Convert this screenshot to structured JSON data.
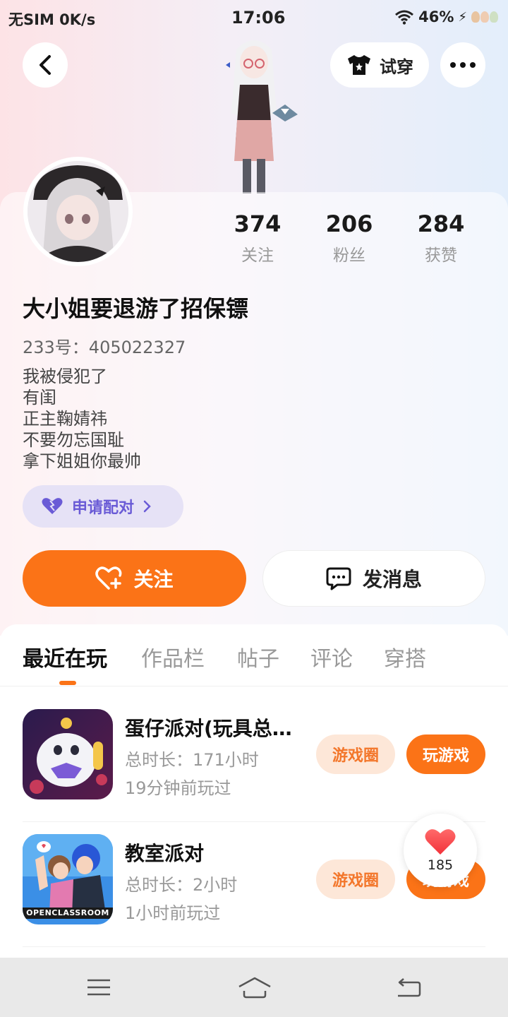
{
  "status_bar": {
    "carrier": "无SIM",
    "speed": "0K/s",
    "time": "17:06",
    "battery": "46%"
  },
  "header": {
    "tryon_label": "试穿"
  },
  "profile": {
    "stats": [
      {
        "value": "374",
        "label": "关注"
      },
      {
        "value": "206",
        "label": "粉丝"
      },
      {
        "value": "284",
        "label": "获赞"
      }
    ],
    "nickname": "大小姐要退游了招保镖",
    "uid": "233号：405022327",
    "bio": [
      "我被侵犯了",
      "有闺",
      "正主鞠婧祎",
      "不要勿忘国耻",
      "拿下姐姐你最帅"
    ],
    "pair_label": "申请配对",
    "follow_label": "关注",
    "message_label": "发消息"
  },
  "tabs": [
    {
      "label": "最近在玩",
      "active": true
    },
    {
      "label": "作品栏",
      "active": false
    },
    {
      "label": "帖子",
      "active": false
    },
    {
      "label": "评论",
      "active": false
    },
    {
      "label": "穿搭",
      "active": false
    }
  ],
  "games": [
    {
      "name": "蛋仔派对(玩具总…",
      "duration": "总时长：171小时",
      "last_played": "19分钟前玩过",
      "circle_label": "游戏圈",
      "play_label": "玩游戏"
    },
    {
      "name": "教室派对",
      "duration": "总时长：2小时",
      "last_played": "1小时前玩过",
      "circle_label": "游戏圈",
      "play_label": "玩游戏"
    }
  ],
  "like_float": {
    "count": "185"
  },
  "game_logo_text": "OPENCLASSROOM",
  "colors": {
    "accent": "#fb7317",
    "pair_bg": "#e6e2f6",
    "pair_text": "#6a5bd6",
    "circle_bg": "#fde7d8"
  },
  "icons": {
    "back": "chevron-left-icon",
    "tryon": "tshirt-icon",
    "more": "more-dots-icon",
    "pair": "heart-pair-icon",
    "follow": "heart-plus-icon",
    "message": "chat-bubble-icon",
    "like": "heart-icon",
    "nav": [
      "menu-icon",
      "home-icon",
      "return-icon"
    ]
  }
}
